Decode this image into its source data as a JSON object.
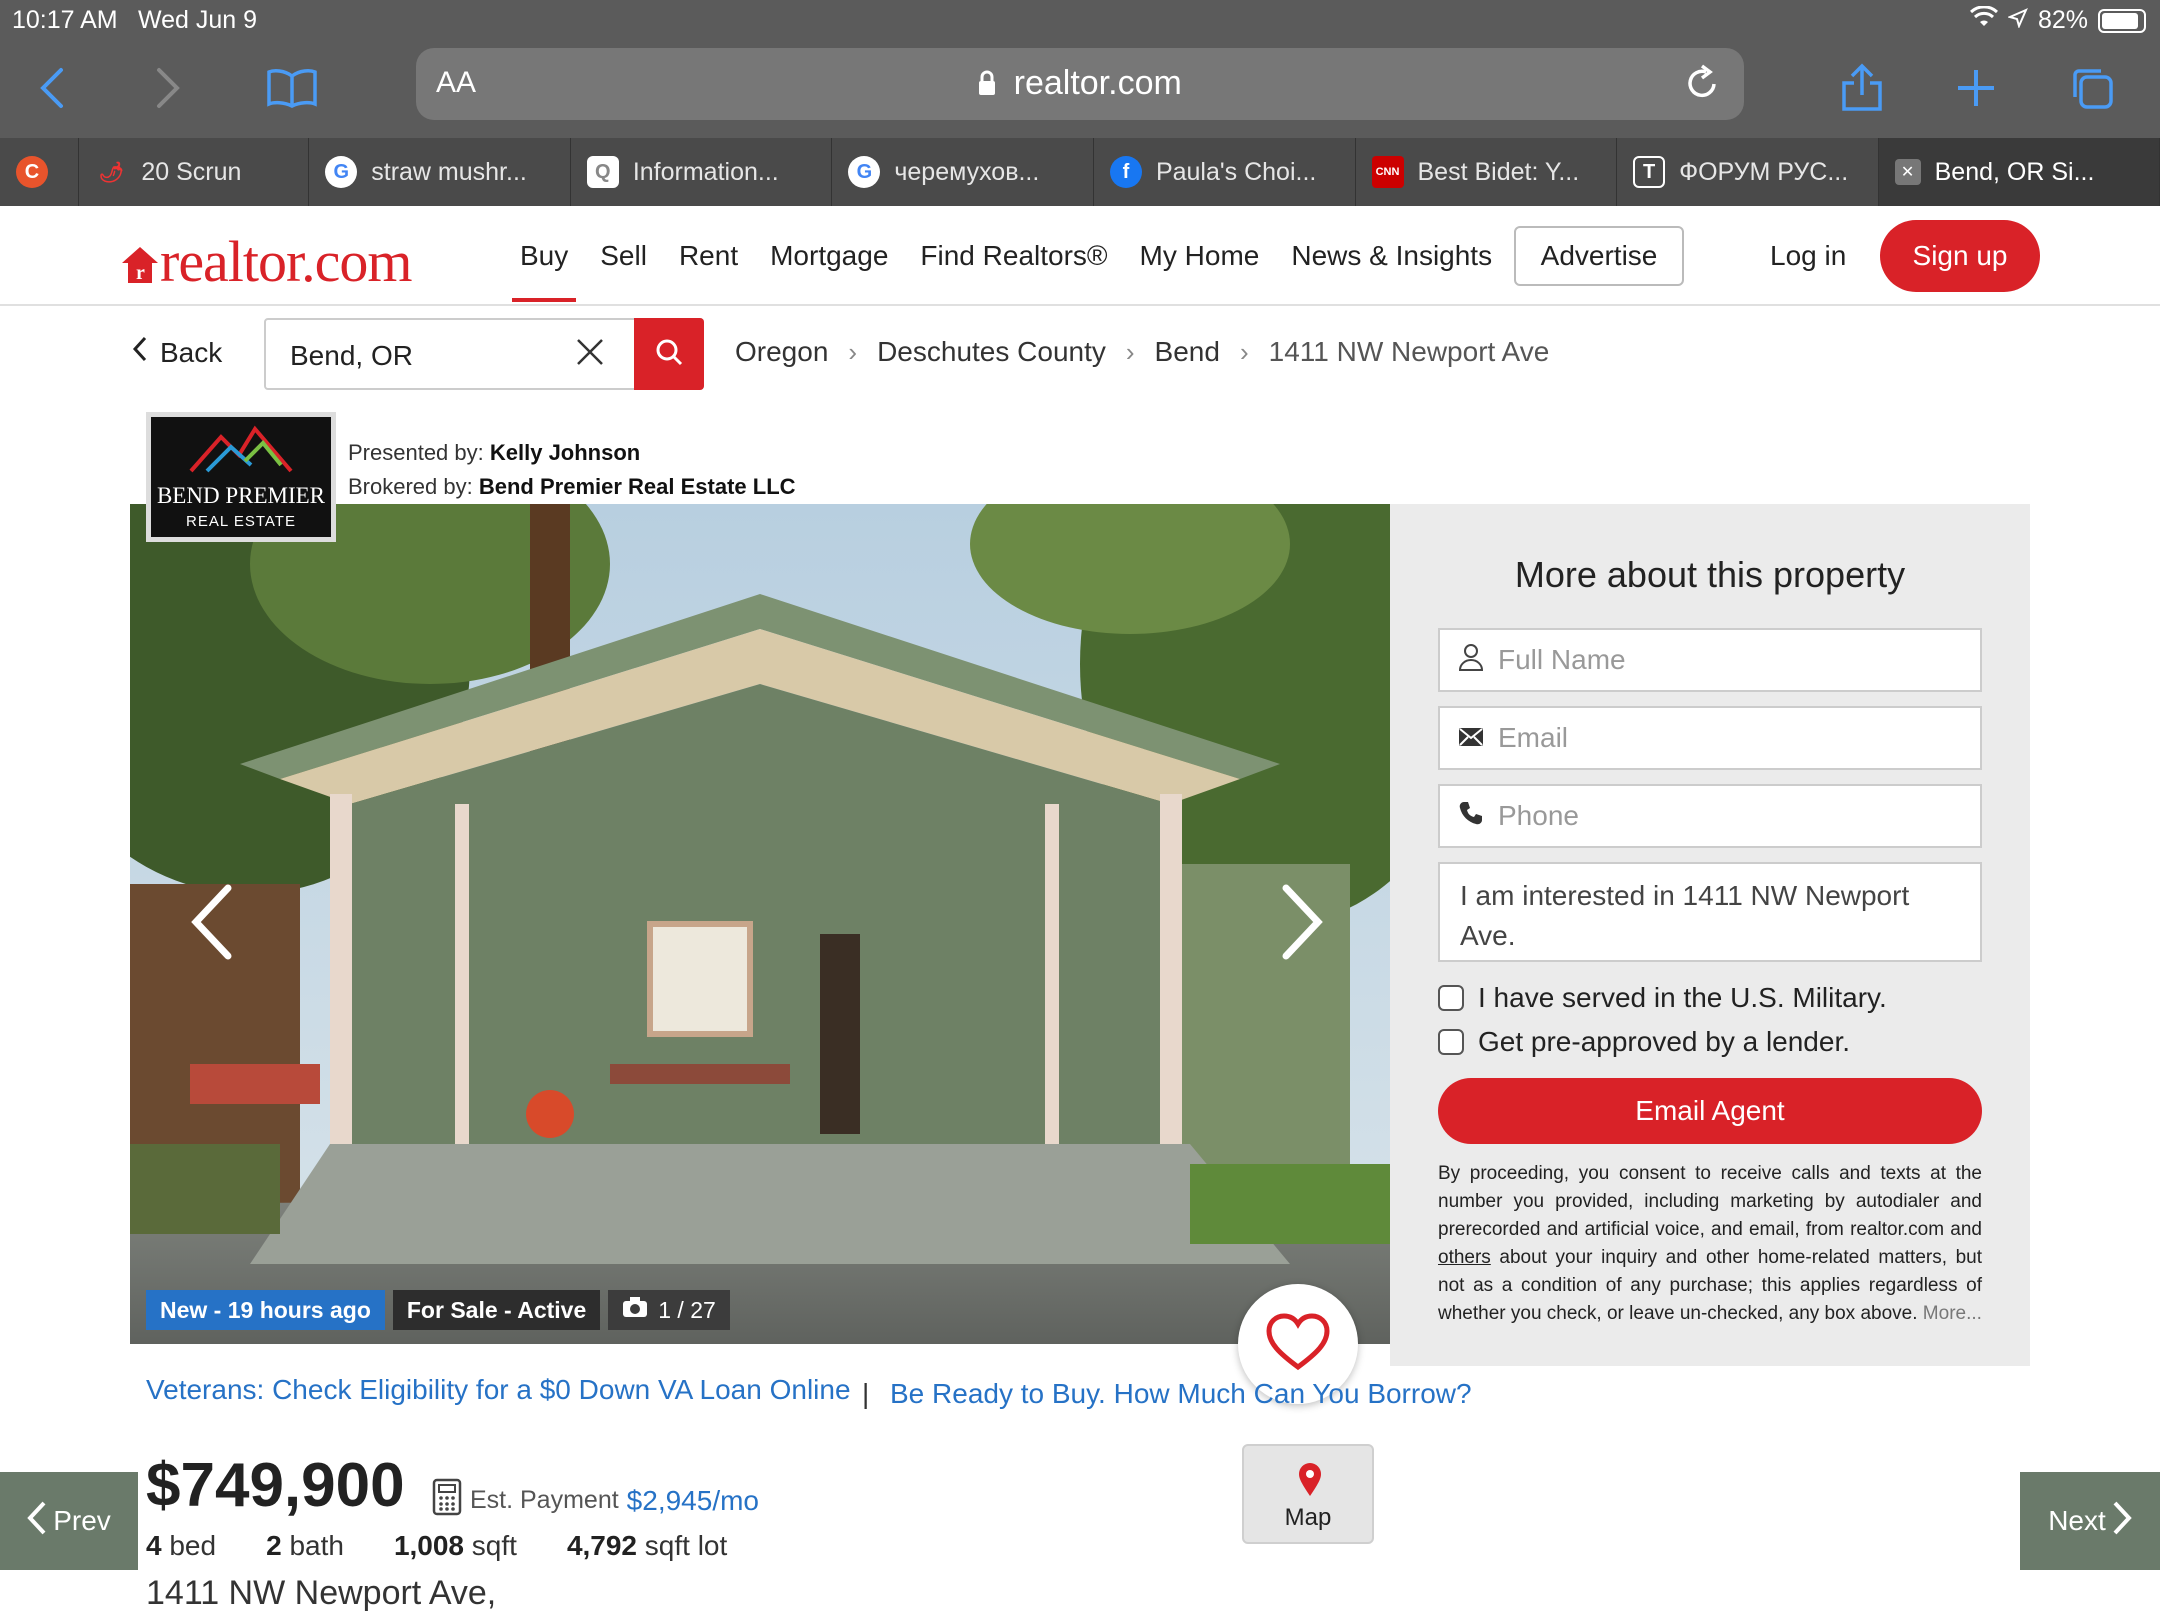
{
  "status": {
    "time": "10:17 AM",
    "date": "Wed Jun 9",
    "battery": "82%"
  },
  "browser": {
    "aa": "AA",
    "url": "realtor.com",
    "tabs": [
      {
        "label": "",
        "fav": "C",
        "color": "#e8542c"
      },
      {
        "label": "20 Scrun",
        "fav": "🌶",
        "color": "#4a4a4a"
      },
      {
        "label": "straw mushr...",
        "fav": "G",
        "color": "#4285f4"
      },
      {
        "label": "Information...",
        "fav": "Q",
        "color": "#888"
      },
      {
        "label": "черемухов...",
        "fav": "G",
        "color": "#4285f4"
      },
      {
        "label": "Paula's Choi...",
        "fav": "f",
        "color": "#1877f2"
      },
      {
        "label": "Best Bidet: Y...",
        "fav": "CNN",
        "color": "#cc0000"
      },
      {
        "label": "ФОРУМ РУС...",
        "fav": "T",
        "color": "#4a4a4a"
      },
      {
        "label": "Bend, OR Si...",
        "fav": "✕",
        "color": "#666"
      }
    ]
  },
  "header": {
    "logo": "realtor.com",
    "nav": [
      "Buy",
      "Sell",
      "Rent",
      "Mortgage",
      "Find Realtors®",
      "My Home",
      "News & Insights"
    ],
    "advertise": "Advertise",
    "login": "Log in",
    "signup": "Sign up"
  },
  "search": {
    "back": "Back",
    "value": "Bend, OR",
    "breadcrumbs": [
      "Oregon",
      "Deschutes County",
      "Bend",
      "1411 NW Newport Ave"
    ]
  },
  "broker": {
    "logo_line1": "BEND PREMIER",
    "logo_line2": "REAL ESTATE",
    "presented_label": "Presented by:",
    "presented_name": "Kelly Johnson",
    "brokered_label": "Brokered by:",
    "brokered_name": "Bend Premier Real Estate LLC"
  },
  "photo": {
    "badge_new": "New - 19 hours ago",
    "badge_status": "For Sale - Active",
    "count": "1 / 27"
  },
  "form": {
    "title": "More about this property",
    "full_name_placeholder": "Full Name",
    "email_placeholder": "Email",
    "phone_placeholder": "Phone",
    "message": "I am interested in 1411 NW Newport Ave.",
    "military": "I have served in the U.S. Military.",
    "preapproved": "Get pre-approved by a lender.",
    "submit": "Email Agent",
    "consent_a": "By proceeding, you consent to receive calls and texts at the number you provided, including marketing by autodialer and prerecorded and artificial voice, and email, from realtor.com and ",
    "consent_link": "others",
    "consent_b": " about your inquiry and other home-related matters, but not as a condition of any purchase; this applies regardless of whether you check, or leave un-checked, any box above. ",
    "consent_more": "More..."
  },
  "promos": {
    "va": "Veterans: Check Eligibility for a $0 Down VA Loan Online",
    "sep": "|",
    "borrow": "Be Ready to Buy. How Much Can You Borrow?"
  },
  "listing": {
    "price": "$749,900",
    "est_label": "Est. Payment",
    "est_value": "$2,945/mo",
    "beds": "4",
    "beds_label": "bed",
    "baths": "2",
    "baths_label": "bath",
    "sqft": "1,008",
    "sqft_label": "sqft",
    "lot": "4,792",
    "lot_label": "sqft lot",
    "address": "1411 NW Newport Ave,"
  },
  "map_label": "Map",
  "prev": "Prev",
  "next": "Next",
  "colors": {
    "brand_red": "#d92228",
    "link_blue": "#2672c6"
  }
}
